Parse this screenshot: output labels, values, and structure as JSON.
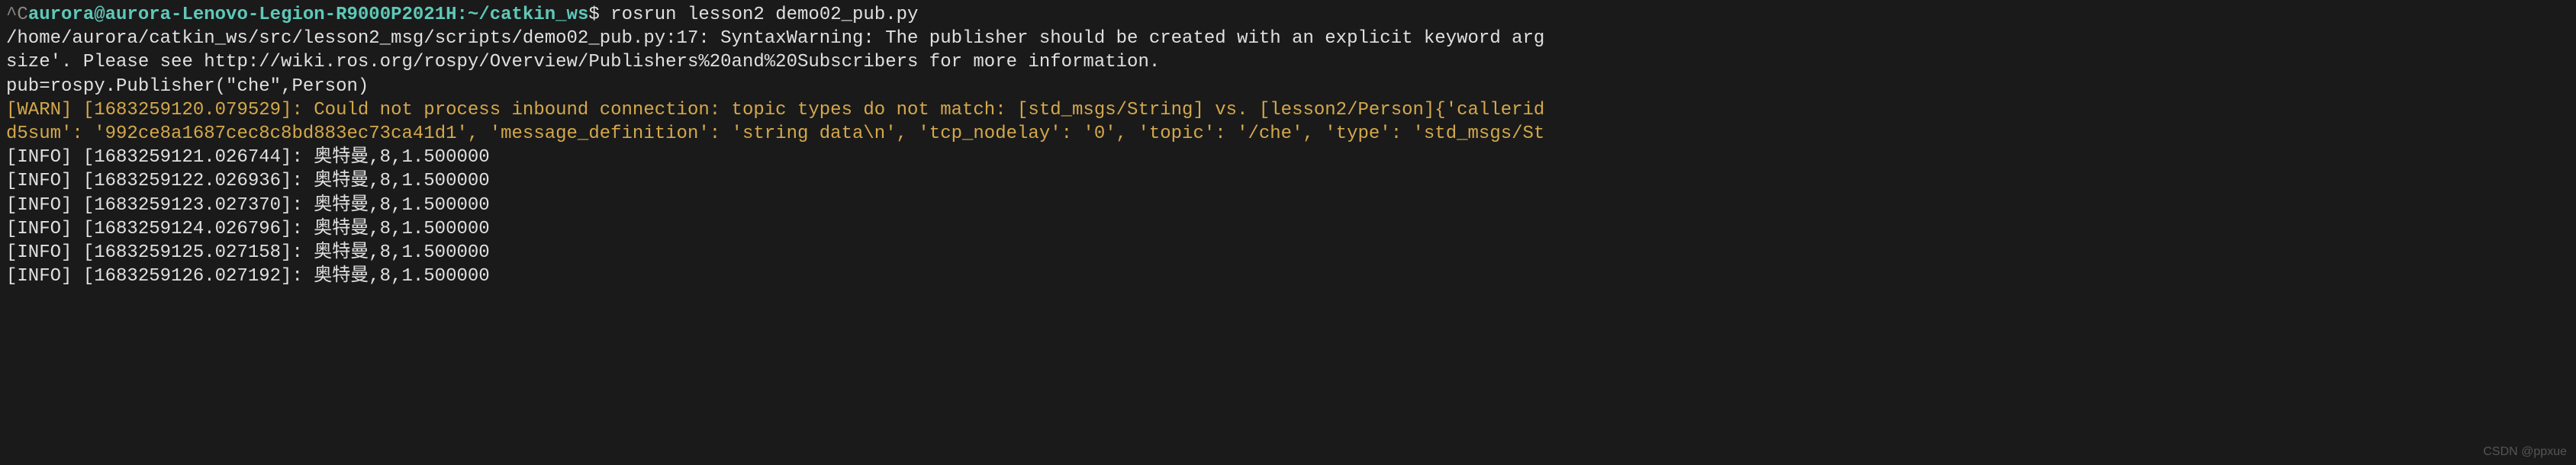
{
  "prompt": {
    "caret_prefix": "^C",
    "user_host": "aurora@aurora-Lenovo-Legion-R9000P2021H",
    "separator": ":",
    "path": "~/catkin_ws",
    "dollar": "$",
    "command": "rosrun lesson2 demo02_pub.py"
  },
  "syntax_warning": {
    "line1": "/home/aurora/catkin_ws/src/lesson2_msg/scripts/demo02_pub.py:17: SyntaxWarning: The publisher should be created with an explicit keyword arg",
    "line2": "size'. Please see http://wiki.ros.org/rospy/Overview/Publishers%20and%20Subscribers for more information.",
    "line3": "  pub=rospy.Publisher(\"che\",Person)"
  },
  "warn": {
    "line1": "[WARN] [1683259120.079529]: Could not process inbound connection: topic types do not match: [std_msgs/String] vs. [lesson2/Person]{'callerid",
    "line2": "d5sum': '992ce8a1687cec8c8bd883ec73ca41d1', 'message_definition': 'string data\\n', 'tcp_nodelay': '0', 'topic': '/che', 'type': 'std_msgs/St"
  },
  "info_lines": [
    "[INFO] [1683259121.026744]: 奥特曼,8,1.500000",
    "[INFO] [1683259122.026936]: 奥特曼,8,1.500000",
    "[INFO] [1683259123.027370]: 奥特曼,8,1.500000",
    "[INFO] [1683259124.026796]: 奥特曼,8,1.500000",
    "[INFO] [1683259125.027158]: 奥特曼,8,1.500000",
    "[INFO] [1683259126.027192]: 奥特曼,8,1.500000"
  ],
  "watermark": "CSDN @ppxue"
}
